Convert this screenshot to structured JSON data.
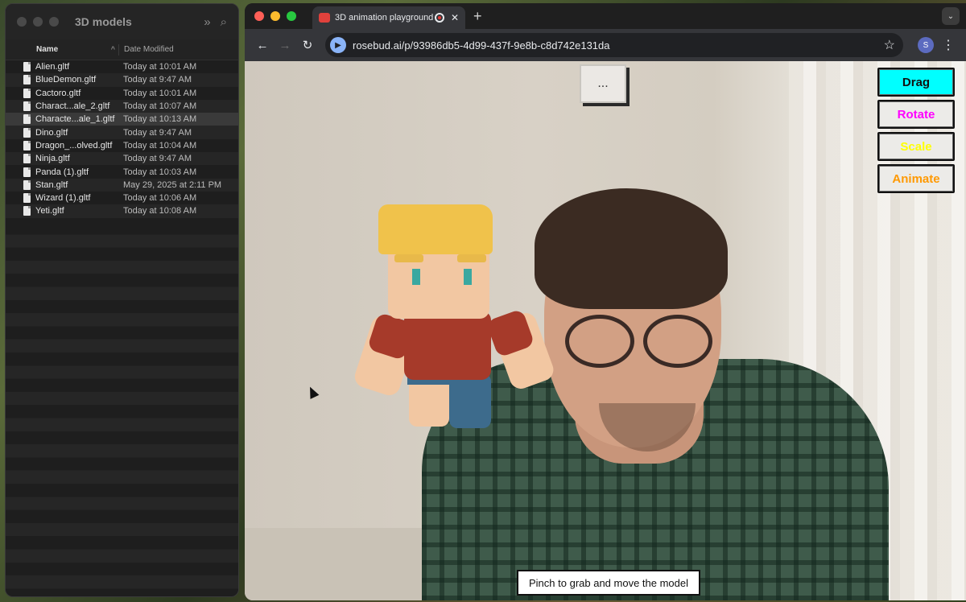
{
  "finder": {
    "title": "3D models",
    "columns": {
      "name": "Name",
      "date": "Date Modified"
    },
    "files": [
      {
        "name": "Alien.gltf",
        "date": "Today at 10:01 AM"
      },
      {
        "name": "BlueDemon.gltf",
        "date": "Today at 9:47 AM"
      },
      {
        "name": "Cactoro.gltf",
        "date": "Today at 10:01 AM"
      },
      {
        "name": "Charact...ale_2.gltf",
        "date": "Today at 10:07 AM"
      },
      {
        "name": "Characte...ale_1.gltf",
        "date": "Today at 10:13 AM",
        "selected": true
      },
      {
        "name": "Dino.gltf",
        "date": "Today at 9:47 AM"
      },
      {
        "name": "Dragon_...olved.gltf",
        "date": "Today at 10:04 AM"
      },
      {
        "name": "Ninja.gltf",
        "date": "Today at 9:47 AM"
      },
      {
        "name": "Panda (1).gltf",
        "date": "Today at 10:03 AM"
      },
      {
        "name": "Stan.gltf",
        "date": "May 29, 2025 at 2:11 PM"
      },
      {
        "name": "Wizard (1).gltf",
        "date": "Today at 10:06 AM"
      },
      {
        "name": "Yeti.gltf",
        "date": "Today at 10:08 AM"
      }
    ]
  },
  "browser": {
    "tab_title": "3D animation playground",
    "url": "rosebud.ai/p/93986db5-4d99-437f-9e8b-c8d742e131da",
    "profile_initial": "S"
  },
  "app": {
    "menu_button": "...",
    "modes": [
      {
        "label": "Drag",
        "color": "#111111",
        "active": true
      },
      {
        "label": "Rotate",
        "color": "#ff00ff",
        "active": false
      },
      {
        "label": "Scale",
        "color": "#ffff00",
        "active": false
      },
      {
        "label": "Animate",
        "color": "#ff9900",
        "active": false
      }
    ],
    "hint": "Pinch to grab and move the model"
  }
}
